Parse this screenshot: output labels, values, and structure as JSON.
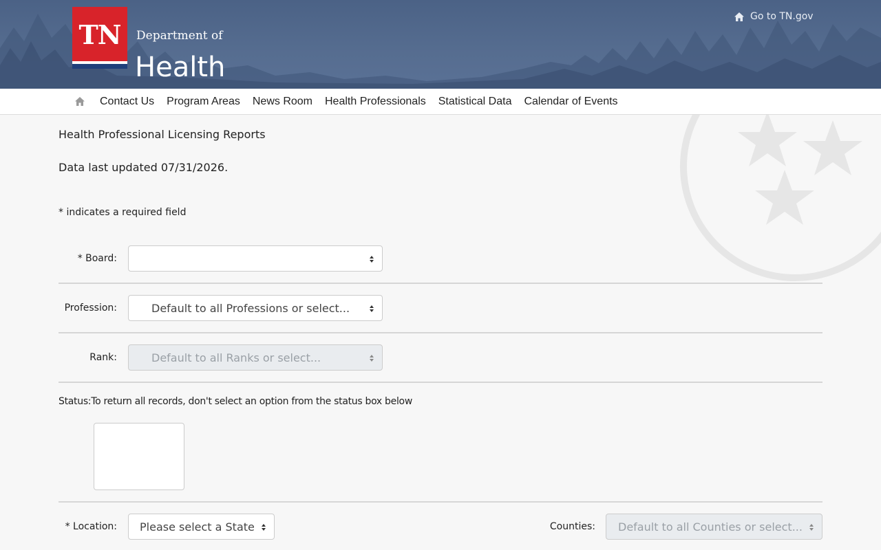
{
  "header": {
    "logo_text": "TN",
    "dept_of": "Department of",
    "dept_name": "Health",
    "goto_label": "Go to TN.gov"
  },
  "nav": {
    "items": [
      "Contact Us",
      "Program Areas",
      "News Room",
      "Health Professionals",
      "Statistical Data",
      "Calendar of Events"
    ]
  },
  "page": {
    "heading": "Health Professional Licensing Reports",
    "updated": "Data last updated 07/31/2026.",
    "required_note": "* indicates a required field"
  },
  "form": {
    "board": {
      "label": "* Board:",
      "value": ""
    },
    "profession": {
      "label": "Profession:",
      "value": "Default to all Professions or select..."
    },
    "rank": {
      "label": "Rank:",
      "value": "Default to all Ranks or select..."
    },
    "status": {
      "text": "Status:To return all records, don't select an option from the status box below"
    },
    "location": {
      "label": "* Location:",
      "value": "Please select a State"
    },
    "counties": {
      "label": "Counties:",
      "value": "Default to all Counties or select..."
    }
  },
  "colors": {
    "banner": "#4b6286",
    "logo_red": "#d8232a",
    "logo_blue": "#1f3f7a",
    "disabled_bg": "#e9ecef"
  }
}
